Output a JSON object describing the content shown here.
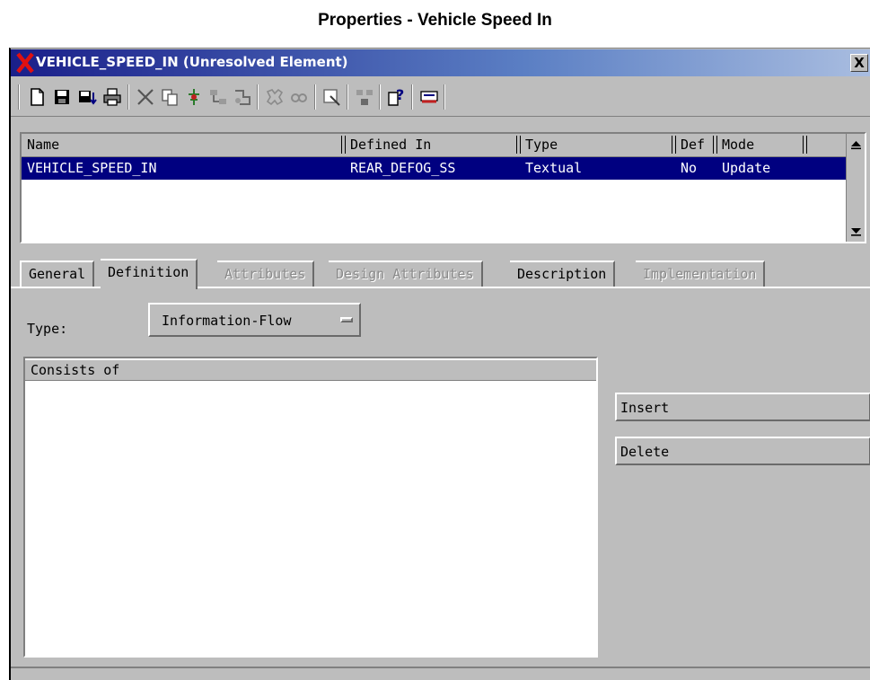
{
  "caption": "Properties - Vehicle Speed In",
  "window": {
    "title": "VEHICLE_SPEED_IN (Unresolved Element)",
    "close_label": "X"
  },
  "toolbar": {
    "icons": [
      "new-icon",
      "save-icon",
      "save-down-icon",
      "print-icon",
      "cut-icon",
      "copy-icon",
      "paste-icon",
      "diagram-icon",
      "locate-icon",
      "find-icon",
      "browse-icon",
      "compare-icon",
      "help-icon",
      "relations-icon"
    ]
  },
  "list": {
    "columns": [
      "Name",
      "Defined In",
      "Type",
      "Def",
      "Mode"
    ],
    "rows": [
      {
        "name": "VEHICLE_SPEED_IN",
        "defined_in": "REAR_DEFOG_SS",
        "type": "Textual",
        "def": "No",
        "mode": "Update"
      }
    ]
  },
  "tabs": [
    {
      "label": "General",
      "state": "normal"
    },
    {
      "label": "Definition",
      "state": "active"
    },
    {
      "label": "Attributes",
      "state": "disabled"
    },
    {
      "label": "Design Attributes",
      "state": "disabled"
    },
    {
      "label": "Description",
      "state": "normal"
    },
    {
      "label": "Implementation",
      "state": "disabled"
    }
  ],
  "definition": {
    "type_label": "Type:",
    "type_value": "Information-Flow",
    "consists_header": "Consists of",
    "insert_label": "Insert",
    "delete_label": "Delete"
  },
  "colors": {
    "selection": "#000080",
    "window_bg": "#bdbdbd",
    "title_icon": "#e01010"
  }
}
